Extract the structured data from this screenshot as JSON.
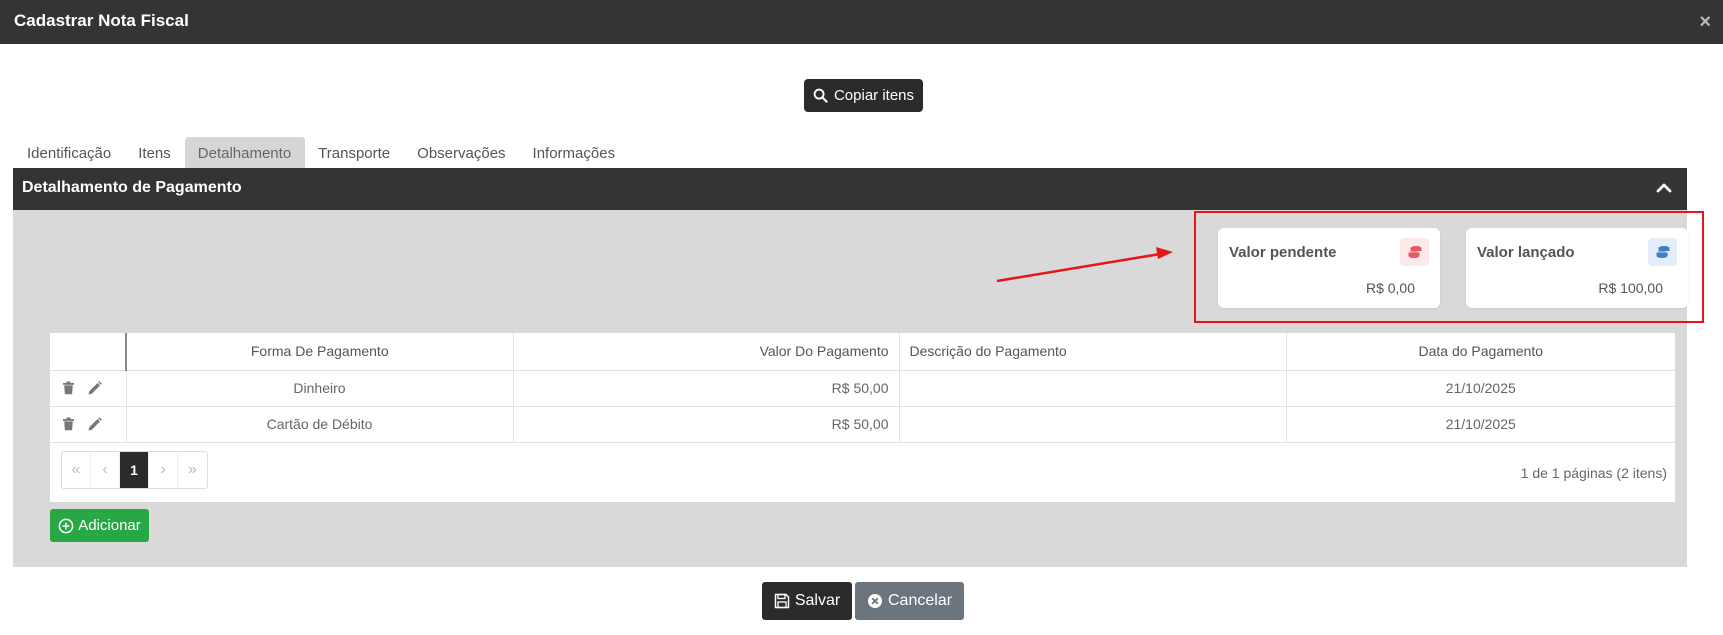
{
  "window": {
    "title": "Cadastrar Nota Fiscal",
    "close_glyph": "×"
  },
  "toolbar": {
    "copy_label": "Copiar itens"
  },
  "tabs": [
    {
      "label": "Identificação"
    },
    {
      "label": "Itens"
    },
    {
      "label": "Detalhamento",
      "active": true
    },
    {
      "label": "Transporte"
    },
    {
      "label": "Observações"
    },
    {
      "label": "Informações"
    }
  ],
  "section": {
    "title": "Detalhamento de Pagamento"
  },
  "cards": {
    "pending": {
      "title": "Valor pendente",
      "value": "R$ 0,00",
      "icon": "coins-icon",
      "icon_color": "#e8585f",
      "icon_bg": "#fde8ea"
    },
    "posted": {
      "title": "Valor lançado",
      "value": "R$ 100,00",
      "icon": "coins-icon",
      "icon_color": "#3f7fc4",
      "icon_bg": "#e3eefa"
    }
  },
  "table": {
    "headers": [
      "Forma De Pagamento",
      "Valor Do Pagamento",
      "Descrição do Pagamento",
      "Data do Pagamento"
    ],
    "rows": [
      {
        "forma": "Dinheiro",
        "valor": "R$ 50,00",
        "descricao": "",
        "data": "21/10/2025"
      },
      {
        "forma": "Cartão de Débito",
        "valor": "R$ 50,00",
        "descricao": "",
        "data": "21/10/2025"
      }
    ]
  },
  "pager": {
    "first": "«",
    "prev": "‹",
    "current": "1",
    "next": "›",
    "last": "»",
    "info": "1 de 1 páginas (2 itens)"
  },
  "actions": {
    "add_label": "Adicionar",
    "save_label": "Salvar",
    "cancel_label": "Cancelar"
  },
  "colors": {
    "dark": "#343434",
    "panel": "#d9d9d9",
    "success": "#28a745",
    "secondary": "#6c757d",
    "annotation": "#e8141b"
  }
}
